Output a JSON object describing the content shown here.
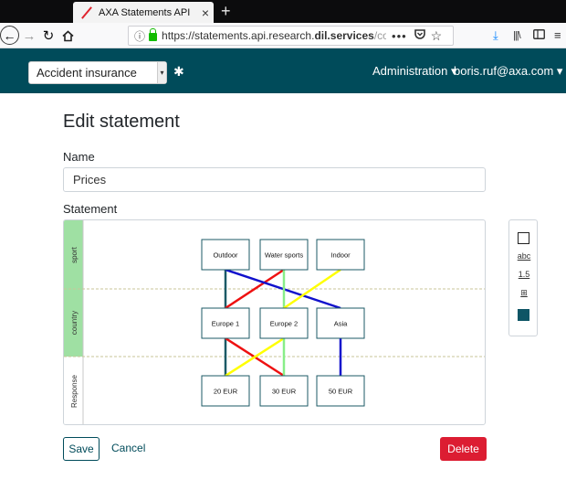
{
  "browser": {
    "tab_title": "AXA Statements API",
    "tab_close": "×",
    "new_tab": "+",
    "url_prefix": "https://statements.api.research.",
    "url_bold": "dil.services",
    "url_suffix": "/contract",
    "url_overflow": "•••",
    "colors": {
      "close": "#ff5f57",
      "minimize": "#febc2e",
      "maximize": "#28c840"
    },
    "icons": [
      "back-icon",
      "forward-icon",
      "reload-icon",
      "home-icon",
      "info-icon",
      "lock-icon",
      "more-icon",
      "pocket-icon",
      "bookmark-star-icon",
      "download-icon",
      "library-icon",
      "sidebar-icon",
      "menu-icon"
    ]
  },
  "app": {
    "insurance_select": "Accident insurance",
    "admin_menu": "Administration ▾",
    "user_menu": "boris.ruf@axa.com ▾",
    "brand_color": "#004b5a"
  },
  "form": {
    "title": "Edit statement",
    "name_label": "Name",
    "name_value": "Prices",
    "statement_label": "Statement",
    "save": "Save",
    "cancel": "Cancel",
    "delete": "Delete"
  },
  "diagram": {
    "rows": [
      "sport",
      "country",
      "Response"
    ],
    "row_colors": {
      "sport": "#9fe0a3",
      "country": "#9fe0a3",
      "Response": "#ffffff"
    },
    "nodes": {
      "sport": [
        "Outdoor",
        "Water sports",
        "Indoor"
      ],
      "country": [
        "Europe 1",
        "Europe 2",
        "Asia"
      ],
      "response": [
        "20 EUR",
        "30 EUR",
        "50 EUR"
      ]
    },
    "edges": [
      {
        "from": "Outdoor",
        "to": "Europe 1",
        "color": "#1b5a66"
      },
      {
        "from": "Water sports",
        "to": "Europe 1",
        "color": "#ee1111"
      },
      {
        "from": "Outdoor",
        "to": "Asia",
        "color": "#1111cc"
      },
      {
        "from": "Water sports",
        "to": "Europe 2",
        "color": "#88ee88"
      },
      {
        "from": "Indoor",
        "to": "Europe 2",
        "color": "#ffff00"
      },
      {
        "from": "Europe 1",
        "to": "20 EUR",
        "color": "#1b5a66"
      },
      {
        "from": "Europe 1",
        "to": "30 EUR",
        "color": "#ee1111"
      },
      {
        "from": "Europe 2",
        "to": "20 EUR",
        "color": "#ffff00"
      },
      {
        "from": "Europe 2",
        "to": "30 EUR",
        "color": "#88ee88"
      },
      {
        "from": "Asia",
        "to": "50 EUR",
        "color": "#1111cc"
      }
    ]
  },
  "toolbox": {
    "text_tool": "abc",
    "number_tool": "1.5",
    "image_tool": "⊞"
  }
}
